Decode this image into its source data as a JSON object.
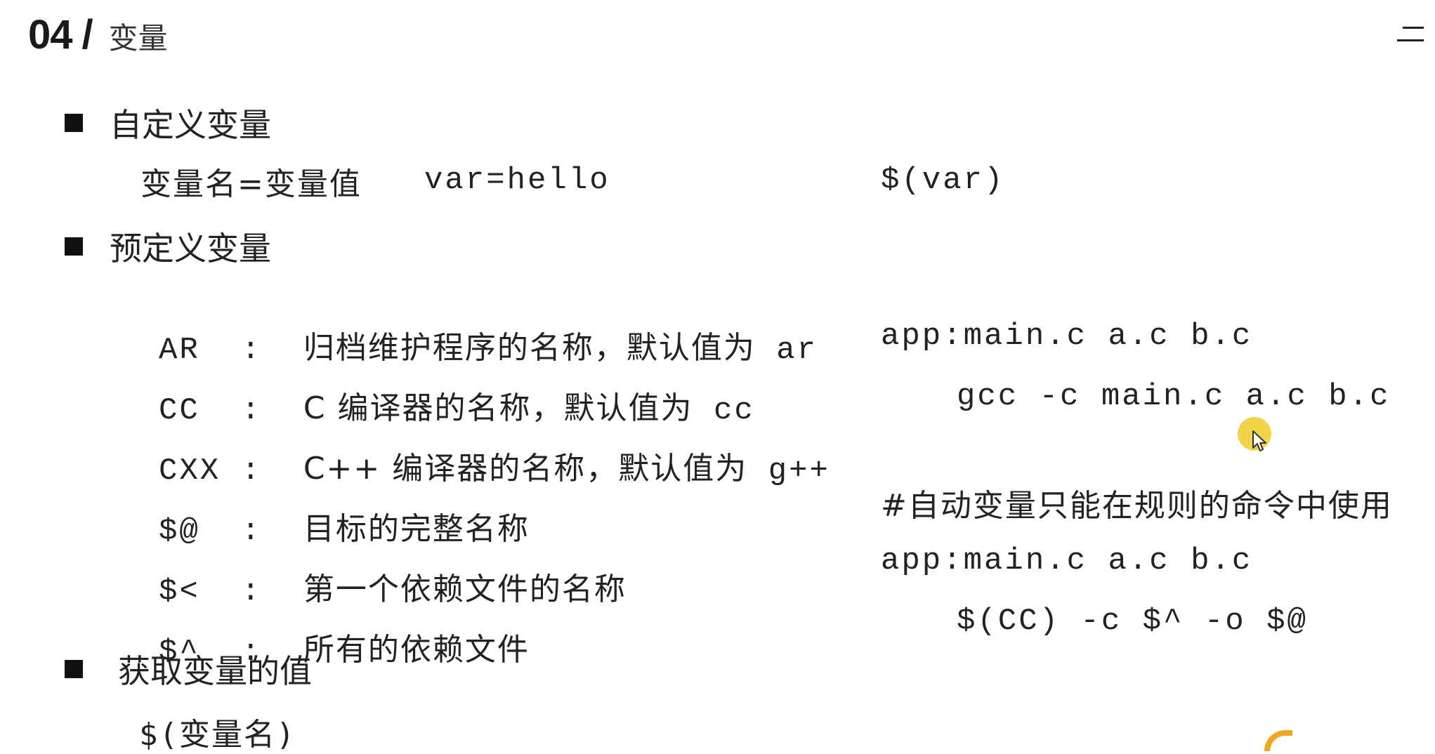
{
  "header": {
    "section_number": "04",
    "separator": "/",
    "section_title": "变量"
  },
  "left": {
    "custom_vars": {
      "heading": "自定义变量",
      "definition": "变量名=变量值",
      "example": "var=hello"
    },
    "predefined_vars": {
      "heading": "预定义变量",
      "items": [
        {
          "name": "AR",
          "desc": "归档维护程序的名称，默认值为",
          "default": "ar"
        },
        {
          "name": "CC",
          "desc": "C 编译器的名称，默认值为",
          "default": "cc"
        },
        {
          "name": "CXX",
          "desc": "C++ 编译器的名称，默认值为",
          "default": "g++"
        },
        {
          "name": "$@",
          "desc": "目标的完整名称",
          "default": ""
        },
        {
          "name": "$<",
          "desc": "第一个依赖文件的名称",
          "default": ""
        },
        {
          "name": "$^",
          "desc": "所有的依赖文件",
          "default": ""
        }
      ]
    },
    "get_value": {
      "heading": "获取变量的值",
      "syntax": "$(变量名)"
    }
  },
  "right": {
    "reference_example": "$(var)",
    "rule1_target": "app:main.c a.c b.c",
    "rule1_command": "gcc -c main.c a.c b.c",
    "comment": "#自动变量只能在规则的命令中使用",
    "rule2_target": "app:main.c a.c b.c",
    "rule2_command": "$(CC) -c $^ -o $@"
  },
  "icons": {
    "menu": "menu-icon",
    "cursor": "mouse-cursor-icon"
  },
  "colors": {
    "accent_logo": "#f0a81c",
    "cursor_halo": "#eecd28"
  }
}
